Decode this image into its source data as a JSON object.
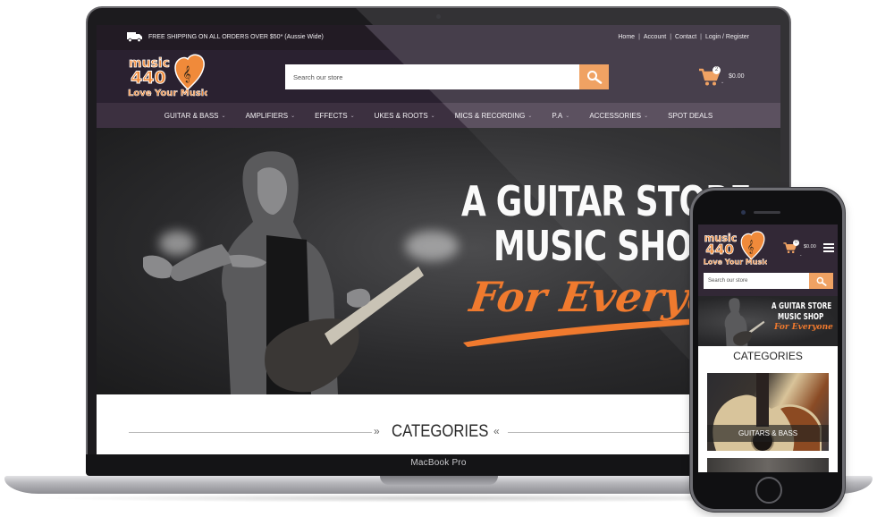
{
  "device_labels": {
    "laptop_model": "MacBook Pro"
  },
  "topbar": {
    "shipping_icon": "truck-icon",
    "shipping_text": "FREE SHIPPING ON ALL ORDERS OVER $50* (Aussie Wide)",
    "links": [
      "Home",
      "Account",
      "Contact",
      "Login / Register"
    ],
    "separator": "|"
  },
  "header": {
    "logo": {
      "line1": "music",
      "line2": "440",
      "tagline": "Love Your Music",
      "icon": "heart-treble-clef-icon"
    },
    "search": {
      "placeholder": "Search our store",
      "button_icon": "search-icon"
    },
    "cart": {
      "icon": "cart-icon",
      "count": "2",
      "total": "$0.00"
    }
  },
  "nav": {
    "items": [
      {
        "label": "GUITAR & BASS",
        "has_dropdown": true
      },
      {
        "label": "AMPLIFIERS",
        "has_dropdown": true
      },
      {
        "label": "EFFECTS",
        "has_dropdown": true
      },
      {
        "label": "UKES & ROOTS",
        "has_dropdown": true
      },
      {
        "label": "MICS & RECORDING",
        "has_dropdown": true
      },
      {
        "label": "P.A",
        "has_dropdown": true
      },
      {
        "label": "ACCESSORIES",
        "has_dropdown": true
      },
      {
        "label": "SPOT DEALS",
        "has_dropdown": false
      }
    ]
  },
  "hero": {
    "line1": "A GUITAR STORE",
    "ampersand": "&",
    "line2": "MUSIC SHOP",
    "line3": "For Everyone",
    "image_alt": "hooded guitarist screaming while playing electric guitar"
  },
  "categories": {
    "title": "CATEGORIES",
    "arrow_left": "»",
    "arrow_right": "«"
  },
  "mobile": {
    "cart_count": "0",
    "cart_total": "$0.00",
    "search_placeholder": "Search our store",
    "hero_line1": "A GUITAR STORE",
    "hero_line2": "MUSIC SHOP",
    "hero_line3": "For Everyone",
    "categories_title": "CATEGORIES",
    "category_cards": [
      {
        "label": "GUITARS & BASS"
      }
    ]
  },
  "colors": {
    "accent_orange": "#f0a263",
    "hero_orange": "#f07a2e",
    "header_dark": "#2a2130",
    "nav_purple": "#3c3040"
  }
}
